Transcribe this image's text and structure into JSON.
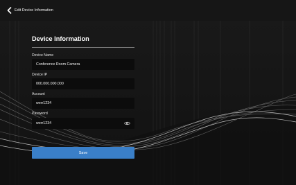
{
  "header": {
    "title": "Edit Device Information",
    "back_icon": "chevron-left-icon"
  },
  "form": {
    "title": "Device Information",
    "fields": [
      {
        "label": "Device Name",
        "value": "Conference Room Camera"
      },
      {
        "label": "Device IP",
        "value": "000.000.000.000"
      },
      {
        "label": "Account",
        "value": "werr1234"
      },
      {
        "label": "Password",
        "value": "werr1234",
        "icon": "eye-icon"
      }
    ],
    "save_label": "Save"
  },
  "colors": {
    "background": "#141414",
    "field_background": "#0c0c0c",
    "accent": "#3a7fc8"
  }
}
